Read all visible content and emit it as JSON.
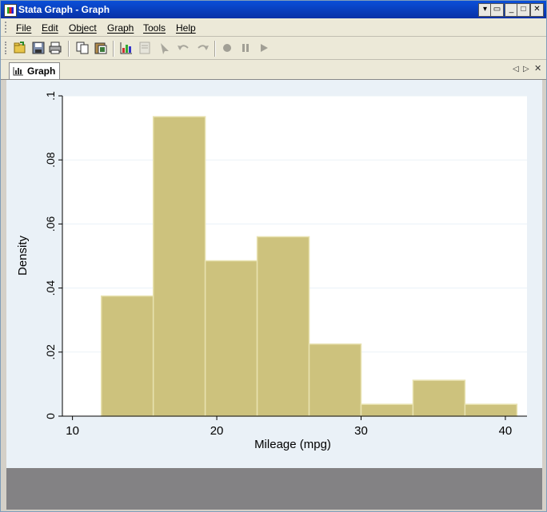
{
  "window": {
    "title": "Stata Graph - Graph"
  },
  "menu": [
    "File",
    "Edit",
    "Object",
    "Graph",
    "Tools",
    "Help"
  ],
  "toolbar": {
    "icons": [
      "open-icon",
      "save-icon",
      "print-icon",
      "copy-icon",
      "paste-icon",
      "graph-editor-icon",
      "properties-icon",
      "pointer-icon",
      "undo-icon",
      "redo-icon",
      "record-icon",
      "pause-icon",
      "play-icon"
    ]
  },
  "tabs": [
    {
      "label": "Graph"
    }
  ],
  "colors": {
    "bar_fill": "#cdc27d",
    "bar_edge": "#e8e2b0",
    "plot_bg": "#ffffff",
    "graph_bg": "#eaf1f7",
    "grid": "#eaf1f7"
  },
  "chart_data": {
    "type": "bar",
    "xlabel": "Mileage (mpg)",
    "ylabel": "Density",
    "xticks": [
      10,
      20,
      30,
      40
    ],
    "yticks": [
      "0",
      ".02",
      ".04",
      ".06",
      ".08",
      ".1"
    ],
    "xlim": [
      9.3,
      41.5
    ],
    "ylim": [
      0,
      0.1
    ],
    "bins": [
      {
        "x0": 12.0,
        "x1": 15.6,
        "density": 0.0375
      },
      {
        "x0": 15.6,
        "x1": 19.2,
        "density": 0.0935
      },
      {
        "x0": 19.2,
        "x1": 22.8,
        "density": 0.0485
      },
      {
        "x0": 22.8,
        "x1": 26.4,
        "density": 0.056
      },
      {
        "x0": 26.4,
        "x1": 30.0,
        "density": 0.0225
      },
      {
        "x0": 30.0,
        "x1": 33.6,
        "density": 0.0037
      },
      {
        "x0": 33.6,
        "x1": 37.2,
        "density": 0.0112
      },
      {
        "x0": 37.2,
        "x1": 40.8,
        "density": 0.0037
      }
    ]
  }
}
